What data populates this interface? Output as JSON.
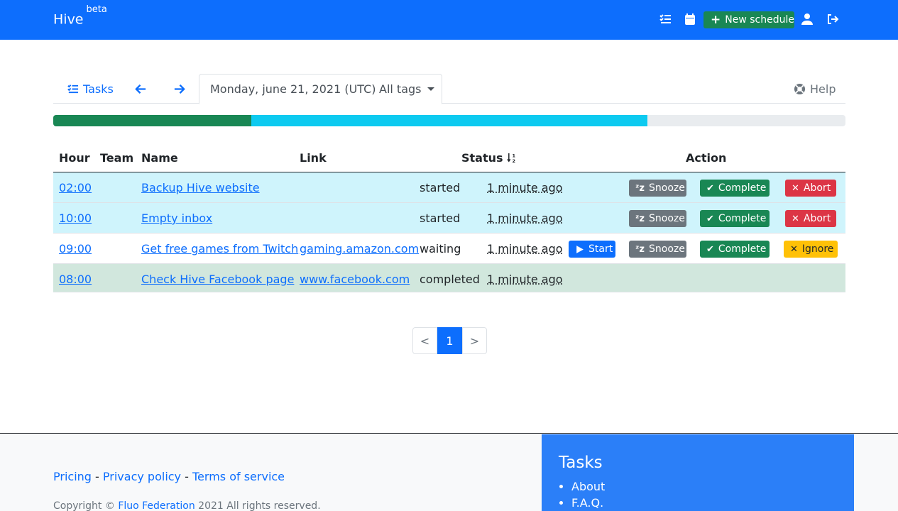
{
  "navbar": {
    "brand": "Hive",
    "brand_sup": "beta",
    "new_schedule_label": "New schedule",
    "icons": [
      "tasks-icon",
      "calendar-icon",
      "user-icon",
      "sign-out-icon"
    ],
    "bg_color": "#0d6efd"
  },
  "tabs": {
    "tasks_label": "Tasks",
    "date_label": "Monday, june 21, 2021 (UTC)",
    "tags_label": "All tags",
    "help_label": "Help"
  },
  "progress": {
    "completed_fraction": 0.25,
    "started_fraction": 0.5,
    "colors": {
      "completed": "#198754",
      "started": "#0dcaf0",
      "track": "#e9ecef"
    }
  },
  "table": {
    "headers": {
      "hour": "Hour",
      "team": "Team",
      "name": "Name",
      "link": "Link",
      "status": "Status",
      "action": "Action"
    },
    "rows": [
      {
        "hour": "02:00",
        "name": "Backup Hive website",
        "link": "",
        "status": "started",
        "time": "1 minute ago",
        "actions": {
          "snooze": "Snooze",
          "complete": "Complete",
          "abort": "Abort"
        }
      },
      {
        "hour": "10:00",
        "name": "Empty inbox",
        "link": "",
        "status": "started",
        "time": "1 minute ago",
        "actions": {
          "snooze": "Snooze",
          "complete": "Complete",
          "abort": "Abort"
        }
      },
      {
        "hour": "09:00",
        "name": "Get free games from Twitch",
        "link": "gaming.amazon.com",
        "status": "waiting",
        "time": "1 minute ago",
        "actions": {
          "start": "Start",
          "snooze": "Snooze",
          "complete": "Complete",
          "ignore": "Ignore"
        }
      },
      {
        "hour": "08:00",
        "name": "Check Hive Facebook page",
        "link": "www.facebook.com",
        "status": "completed",
        "time": "1 minute ago",
        "actions": {}
      }
    ],
    "row_colors": {
      "started": "#cff4fc",
      "waiting": "#ffffff",
      "completed": "#d1e7dd"
    }
  },
  "pagination": {
    "prev": "<",
    "current": "1",
    "next": ">"
  },
  "footer": {
    "pricing": "Pricing",
    "privacy": "Privacy policy",
    "terms": "Terms of service",
    "sep": "-",
    "copyright_prefix": "Copyright ©",
    "copyright_link": "Fluo Federation",
    "copyright_suffix": "2021 All rights reserved.",
    "box_title": "Tasks",
    "box_items": [
      "About",
      "F.A.Q."
    ]
  }
}
